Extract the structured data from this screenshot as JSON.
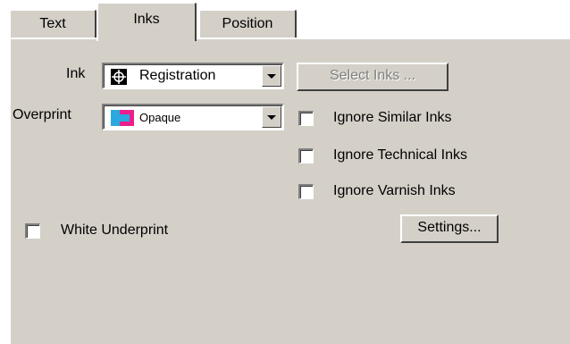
{
  "tabs": [
    {
      "label": "Text"
    },
    {
      "label": "Inks",
      "active": true
    },
    {
      "label": "Position"
    }
  ],
  "ink": {
    "label": "Ink",
    "value": "Registration",
    "icon": "registration-mark-icon"
  },
  "select_inks_button": {
    "label": "Select Inks ...",
    "disabled": true
  },
  "overprint": {
    "label": "Overprint",
    "value": "Opaque",
    "icon": "opaque-overprint-swatch-icon"
  },
  "checkboxes": [
    {
      "label": "Ignore Similar Inks",
      "checked": false
    },
    {
      "label": "Ignore Technical Inks",
      "checked": false
    },
    {
      "label": "Ignore Varnish Inks",
      "checked": false
    }
  ],
  "white_underprint": {
    "label": "White Underprint",
    "checked": false
  },
  "settings_button": {
    "label": "Settings..."
  },
  "colors": {
    "panel": "#d4d0c8",
    "swatch_cyan": "#29a9e0",
    "swatch_magenta": "#ec1e8c"
  }
}
